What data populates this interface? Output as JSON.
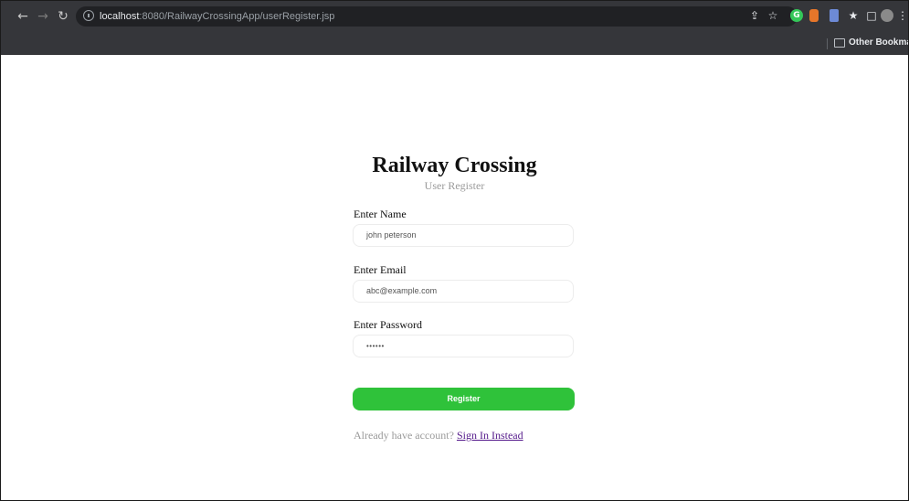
{
  "browser": {
    "url_host": "localhost",
    "url_path": ":8080/RailwayCrossingApp/userRegister.jsp",
    "bookmarks_folder_label": "Other Bookmarks",
    "icons": {
      "back": "←",
      "forward": "→",
      "reload": "↻",
      "share": "⇪",
      "star": "☆",
      "extension_g": "G",
      "extensions": "★",
      "side_panel": "□",
      "menu": "⋮"
    }
  },
  "page": {
    "title": "Railway Crossing",
    "subtitle": "User Register",
    "fields": [
      {
        "label": "Enter Name",
        "value": "john peterson"
      },
      {
        "label": "Enter Email",
        "value": "abc@example.com"
      },
      {
        "label": "Enter Password",
        "value": "••••••"
      }
    ],
    "register_label": "Register",
    "signin_prompt": "Already have account?",
    "signin_link": "Sign In Instead"
  },
  "colors": {
    "button": "#2fc23a",
    "link": "#551a8b",
    "chrome": "#35363a"
  }
}
